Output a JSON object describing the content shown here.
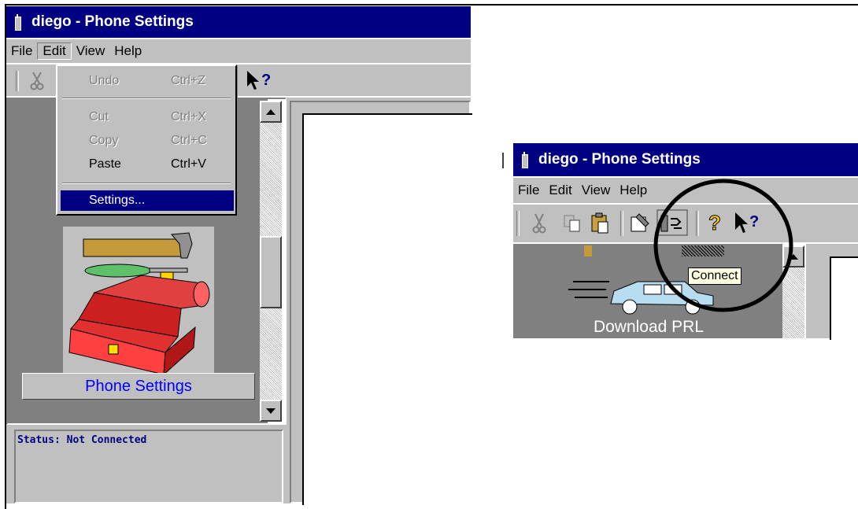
{
  "left_window": {
    "title": "diego - Phone Settings",
    "menu": [
      "File",
      "Edit",
      "View",
      "Help"
    ],
    "edit_menu": [
      {
        "label": "Undo",
        "shortcut": "Ctrl+Z",
        "enabled": false
      },
      {
        "label": "Cut",
        "shortcut": "Ctrl+X",
        "enabled": false
      },
      {
        "label": "Copy",
        "shortcut": "Ctrl+C",
        "enabled": false
      },
      {
        "label": "Paste",
        "shortcut": "Ctrl+V",
        "enabled": true
      },
      {
        "label": "Settings...",
        "shortcut": "",
        "enabled": true,
        "highlighted": true
      }
    ],
    "panel_item_label": "Phone Settings",
    "status": "Status: Not Connected"
  },
  "right_window": {
    "title": "diego - Phone Settings",
    "menu": [
      "File",
      "Edit",
      "View",
      "Help"
    ],
    "tooltip": "Connect",
    "panel_item_label": "Download PRL"
  },
  "colors": {
    "titlebar": "#000080",
    "face": "#c0c0c0",
    "selection": "#000080",
    "link_text": "#0000ff"
  }
}
